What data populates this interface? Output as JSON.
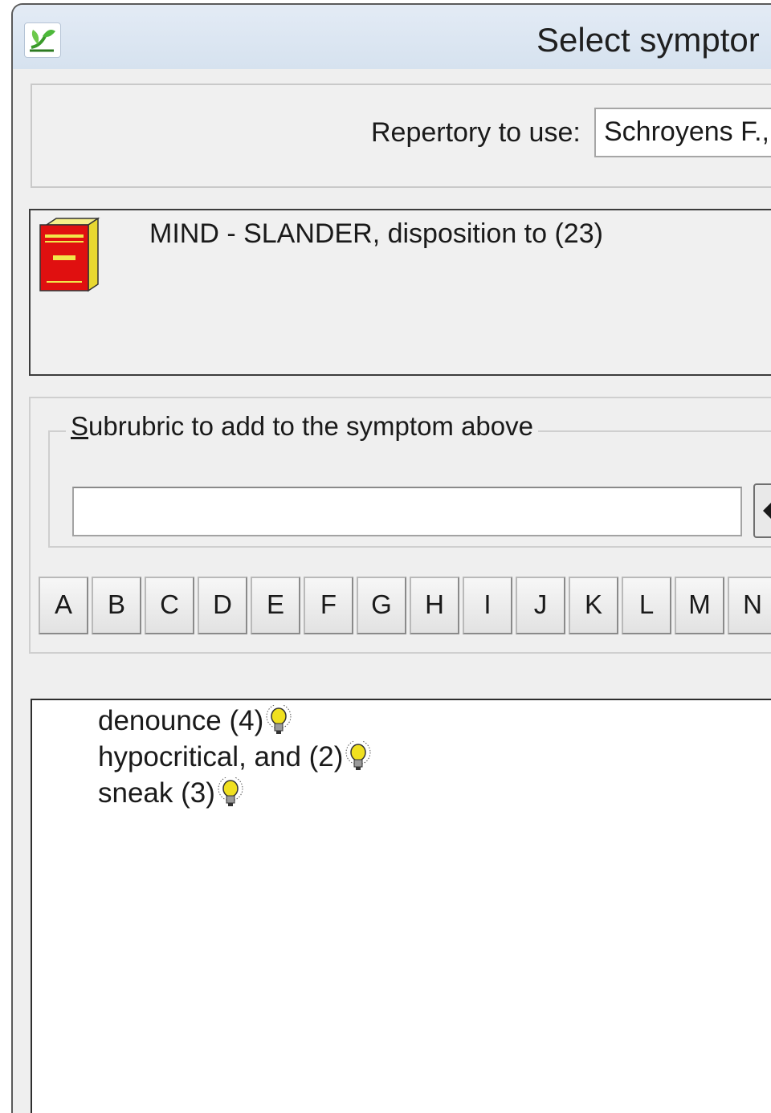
{
  "window": {
    "title": "Select symptor",
    "app_icon": "leaf-app-icon"
  },
  "repertory": {
    "label": "Repertory to use:",
    "value": "Schroyens F., S"
  },
  "symptom": {
    "icon": "book-icon",
    "text": "MIND - SLANDER, disposition to (23)"
  },
  "subrubric": {
    "legend_accel": "S",
    "legend_rest": "ubrubric to add to the symptom above",
    "input_value": ""
  },
  "alphabet": [
    "A",
    "B",
    "C",
    "D",
    "E",
    "F",
    "G",
    "H",
    "I",
    "J",
    "K",
    "L",
    "M",
    "N"
  ],
  "list": {
    "items": [
      {
        "label": "denounce (4)",
        "icon": "lightbulb-icon"
      },
      {
        "label": "hypocritical, and (2)",
        "icon": "lightbulb-icon"
      },
      {
        "label": "sneak (3)",
        "icon": "lightbulb-icon"
      }
    ]
  },
  "colors": {
    "titlebar": "#d6e2ef",
    "dialog_bg": "#efefef",
    "book_red": "#e01010",
    "book_yellow": "#f2e64a",
    "bulb_yellow": "#f0e020"
  }
}
